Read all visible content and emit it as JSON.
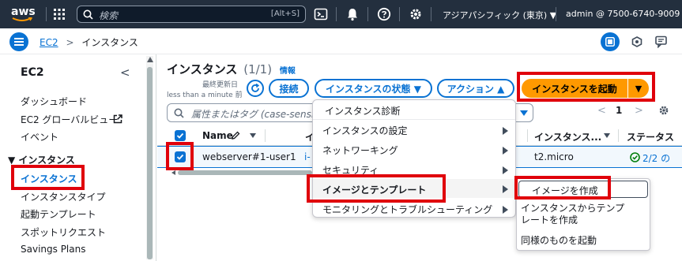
{
  "topbar": {
    "logo": "aws",
    "search_placeholder": "検索",
    "shortcut": "[Alt+S]",
    "region": "アジアパシフィック (東京) ▼",
    "account": "admin @ 7500-6740-9009 ▼"
  },
  "breadcrumb": {
    "root": "EC2",
    "separator": ">",
    "current": "インスタンス"
  },
  "sidebar": {
    "title": "EC2",
    "collapse_icon": "<",
    "items": [
      {
        "label": "ダッシュボード"
      },
      {
        "label": "EC2 グローバルビュー"
      },
      {
        "label": "イベント"
      }
    ],
    "section_title": "▼ インスタンス",
    "section_items": [
      {
        "label": "インスタンス"
      },
      {
        "label": "インスタンスタイプ"
      },
      {
        "label": "起動テンプレート"
      },
      {
        "label": "スポットリクエスト"
      },
      {
        "label": "Savings Plans"
      }
    ]
  },
  "main": {
    "title": "インスタンス",
    "count": "(1/1)",
    "info_link": "情報",
    "last_updated_label": "最終更新日",
    "last_updated_value": "less than a minute 前",
    "connect_button": "接続",
    "state_button": "インスタンスの状態 ▼",
    "actions_button": "アクション ▲",
    "launch_button": "インスタンスを起動",
    "launch_dropdown": "▼",
    "filter_placeholder": "属性またはタグ (case-sensitive",
    "pagination_prev": "<",
    "page_number": "1",
    "pagination_next": ">",
    "columns": {
      "name": "Name",
      "instance_id_partial": "イ",
      "instance_type": "インスタンス...",
      "status": "ステータス"
    },
    "row": {
      "name": "webserver#1-user1",
      "id_partial": "i-",
      "instance_type": "t2.micro",
      "status_checks": "2/2 の"
    }
  },
  "actions_menu": {
    "items": [
      {
        "label": "インスタンス診断",
        "has_submenu": false
      },
      {
        "label": "インスタンスの設定",
        "has_submenu": true
      },
      {
        "label": "ネットワーキング",
        "has_submenu": true
      },
      {
        "label": "セキュリティ",
        "has_submenu": true
      },
      {
        "label": "イメージとテンプレート",
        "has_submenu": true
      },
      {
        "label": "モニタリングとトラブルシューティング",
        "has_submenu": true
      }
    ]
  },
  "submenu": {
    "items": [
      {
        "label": "イメージを作成"
      },
      {
        "label": "インスタンスからテンプレートを作成"
      },
      {
        "label": "同様のものを起動"
      }
    ]
  },
  "colors": {
    "topbar_bg": "#232f3e",
    "primary_blue": "#0972d3",
    "launch_orange": "#ff9900",
    "highlight_red": "#e0000b",
    "success_green": "#037f0c"
  }
}
